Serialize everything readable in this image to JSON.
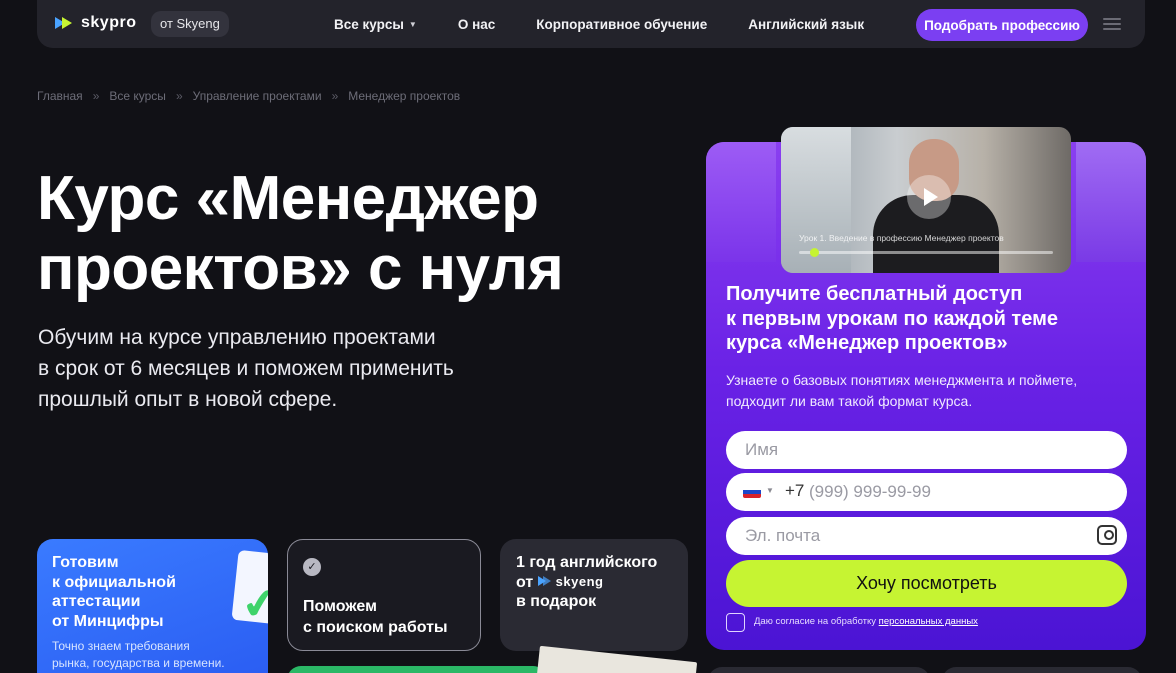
{
  "header": {
    "logo": "skypro",
    "by_badge": "от Skyeng",
    "nav": [
      "Все курсы",
      "О нас",
      "Корпоративное обучение",
      "Английский язык"
    ],
    "cta": "Подобрать профессию"
  },
  "breadcrumb": [
    "Главная",
    "Все курсы",
    "Управление проектами",
    "Менеджер проектов"
  ],
  "breadcrumb_sep": "»",
  "hero": {
    "title_line1": "Курс «Менеджер",
    "title_line2": "проектов» с нуля",
    "sub_line1": "Обучим на курсе управлению проектами",
    "sub_line2": "в срок от 6 месяцев и поможем применить",
    "sub_line3": "прошлый опыт в новой сфере."
  },
  "cards": {
    "attest": {
      "line1": "Готовим",
      "line2": "к официальной",
      "line3": "аттестации",
      "line4": "от Минцифры",
      "small1": "Точно знаем требования",
      "small2": "рынка, государства и времени."
    },
    "job": {
      "line1": "Поможем",
      "line2": "с поиском работы"
    },
    "english": {
      "line1": "1 год английского",
      "line2_prefix": "от",
      "brand": "skyeng",
      "line3": "в подарок"
    }
  },
  "form": {
    "video_caption": "Урок 1. Введение в профессию Менеджер проектов",
    "title_line1": "Получите бесплатный доступ",
    "title_line2": "к первым урокам по каждой теме",
    "title_line3": "курса «Менеджер проектов»",
    "desc_line1": "Узнаете о базовых понятиях менеджмента и поймете,",
    "desc_line2": "подходит ли вам такой формат курса.",
    "name_placeholder": "Имя",
    "phone_code": "+7",
    "phone_placeholder": "(999) 999-99-99",
    "email_placeholder": "Эл. почта",
    "submit": "Хочу посмотреть",
    "consent_text": "Даю согласие на обработку",
    "consent_link": "персональных данных"
  },
  "colors": {
    "accent_purple": "#7b3ff2",
    "accent_lime": "#c6f432",
    "card_blue": "#3a7bff",
    "bg": "#111116"
  }
}
